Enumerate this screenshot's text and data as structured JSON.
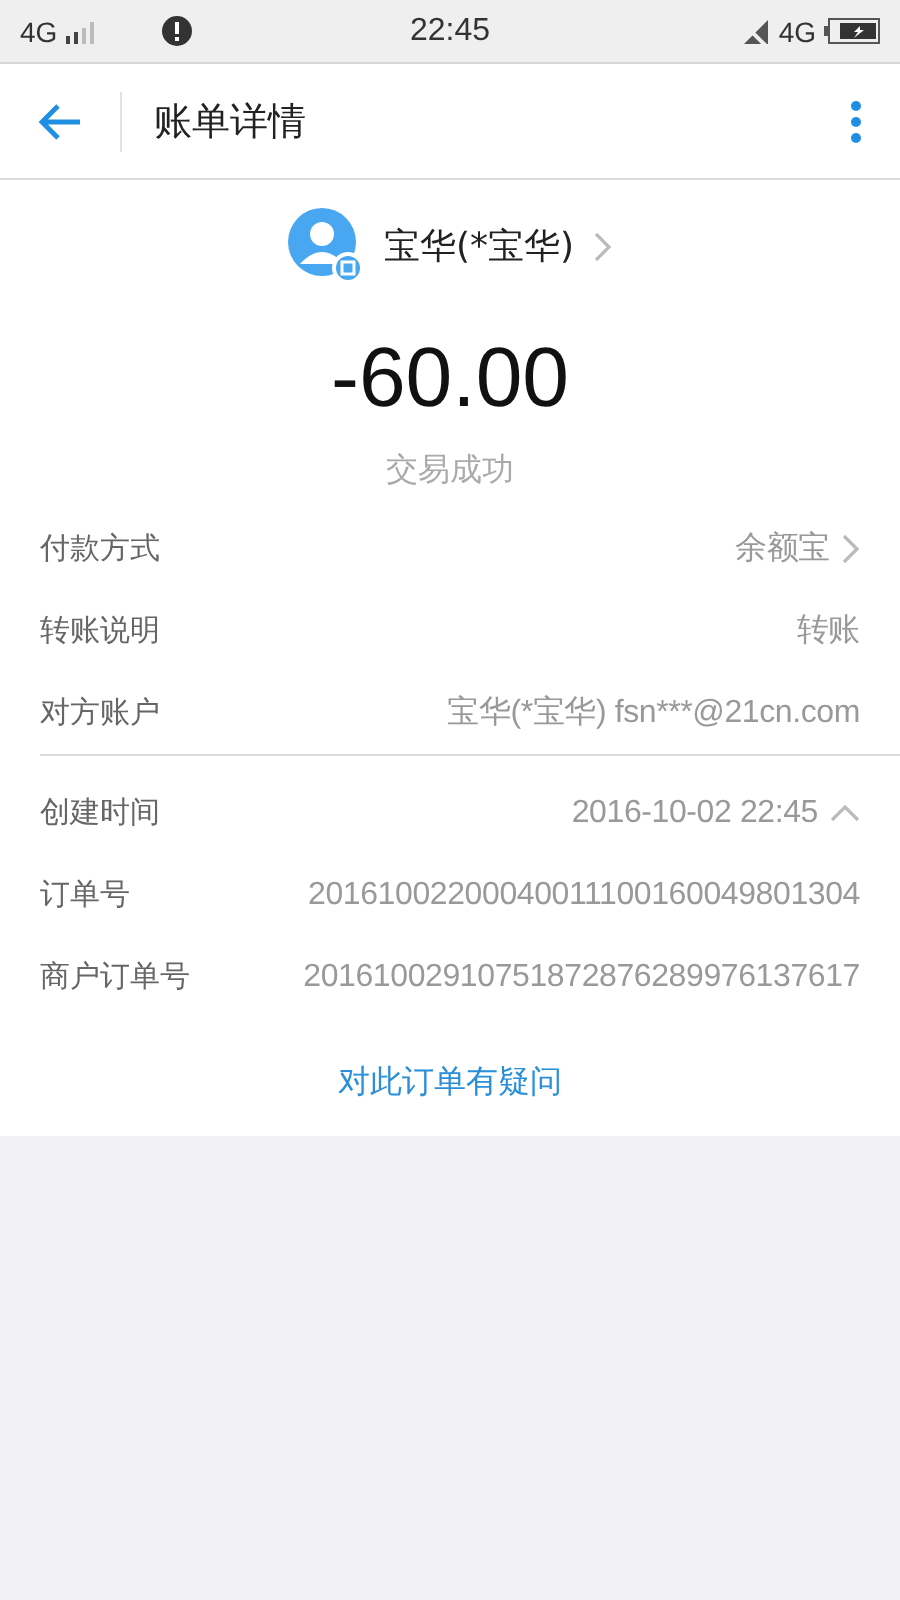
{
  "status_bar": {
    "network_left": "4G",
    "time": "22:45",
    "network_right": "4G"
  },
  "app_bar": {
    "title": "账单详情"
  },
  "payee": {
    "name": "宝华(*宝华)"
  },
  "amount": "-60.00",
  "status": "交易成功",
  "groups": [
    {
      "rows": [
        {
          "label": "付款方式",
          "value": "余额宝",
          "kind": "link"
        },
        {
          "label": "转账说明",
          "value": "转账",
          "kind": "plain"
        },
        {
          "label": "对方账户",
          "value": "宝华(*宝华) fsn***@21cn.com",
          "kind": "plain"
        }
      ]
    },
    {
      "rows": [
        {
          "label": "创建时间",
          "value": "2016-10-02 22:45",
          "kind": "expander",
          "expanded": true
        },
        {
          "label": "订单号",
          "value": "20161002200040011100160049801304",
          "kind": "plain"
        },
        {
          "label": "商户订单号",
          "value": "20161002910751872876289976137617",
          "kind": "plain"
        }
      ]
    }
  ],
  "question_link": "对此订单有疑问"
}
